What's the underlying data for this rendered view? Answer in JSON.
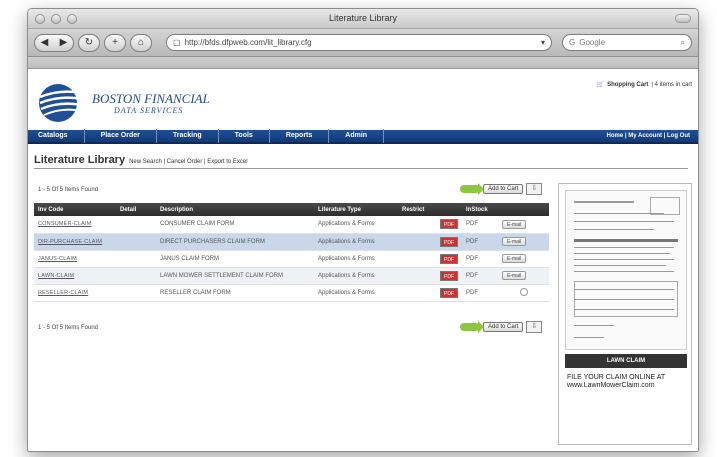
{
  "window": {
    "title": "Literature Library"
  },
  "toolbar": {
    "url": "http://bfds.dfpweb.com/lit_library.cfg",
    "search_placeholder": "Google"
  },
  "brand": {
    "name": "BOSTON FINANCIAL",
    "subtitle": "DATA SERVICES",
    "primary_color": "#1e4f97"
  },
  "cart": {
    "label": "Shopping Cart",
    "count_text": "| 4 items in cart"
  },
  "nav": {
    "items": [
      "Catalogs",
      "Place Order",
      "Tracking",
      "Tools",
      "Reports",
      "Admin"
    ],
    "right_links": "Home | My Account | Log Out"
  },
  "heading": {
    "title": "Literature Library",
    "links": "New Search | Cancel Order | Export to Excel"
  },
  "results": {
    "top_count": "1 - 5 Of 5 Items Found",
    "bottom_count": "1 - 5 Of 5 Items Found",
    "add_to_cart": "Add to Cart"
  },
  "table": {
    "headers": [
      "Inv Code",
      "Detail",
      "Description",
      "Literature Type",
      "Restrict",
      "InStock"
    ],
    "rows": [
      {
        "code": "CONSUMER-CLAIM",
        "description": "CONSUMER CLAIM FORM",
        "type": "Applications & Forms",
        "format": "PDF",
        "action": "E-mail"
      },
      {
        "code": "DIR-PURCHASE-CLAIM",
        "description": "DIRECT PURCHASERS CLAIM FORM",
        "type": "Applications & Forms",
        "format": "PDF",
        "action": "E-mail"
      },
      {
        "code": "JANUS-CLAIM",
        "description": "JANUS CLAIM FORM",
        "type": "Applications & Forms",
        "format": "PDF",
        "action": "E-mail"
      },
      {
        "code": "LAWN-CLAIM",
        "description": "LAWN MOWER SETTLEMENT CLAIM FORM",
        "type": "Applications & Forms",
        "format": "PDF",
        "action": "E-mail"
      },
      {
        "code": "RESELLER-CLAIM",
        "description": "RESELLER CLAIM FORM",
        "type": "Applications & Forms",
        "format": "PDF",
        "action": ""
      }
    ]
  },
  "preview": {
    "label": "LAWN CLAIM",
    "text": "FILE YOUR CLAIM ONLINE AT www.LawnMowerClaim.com"
  }
}
